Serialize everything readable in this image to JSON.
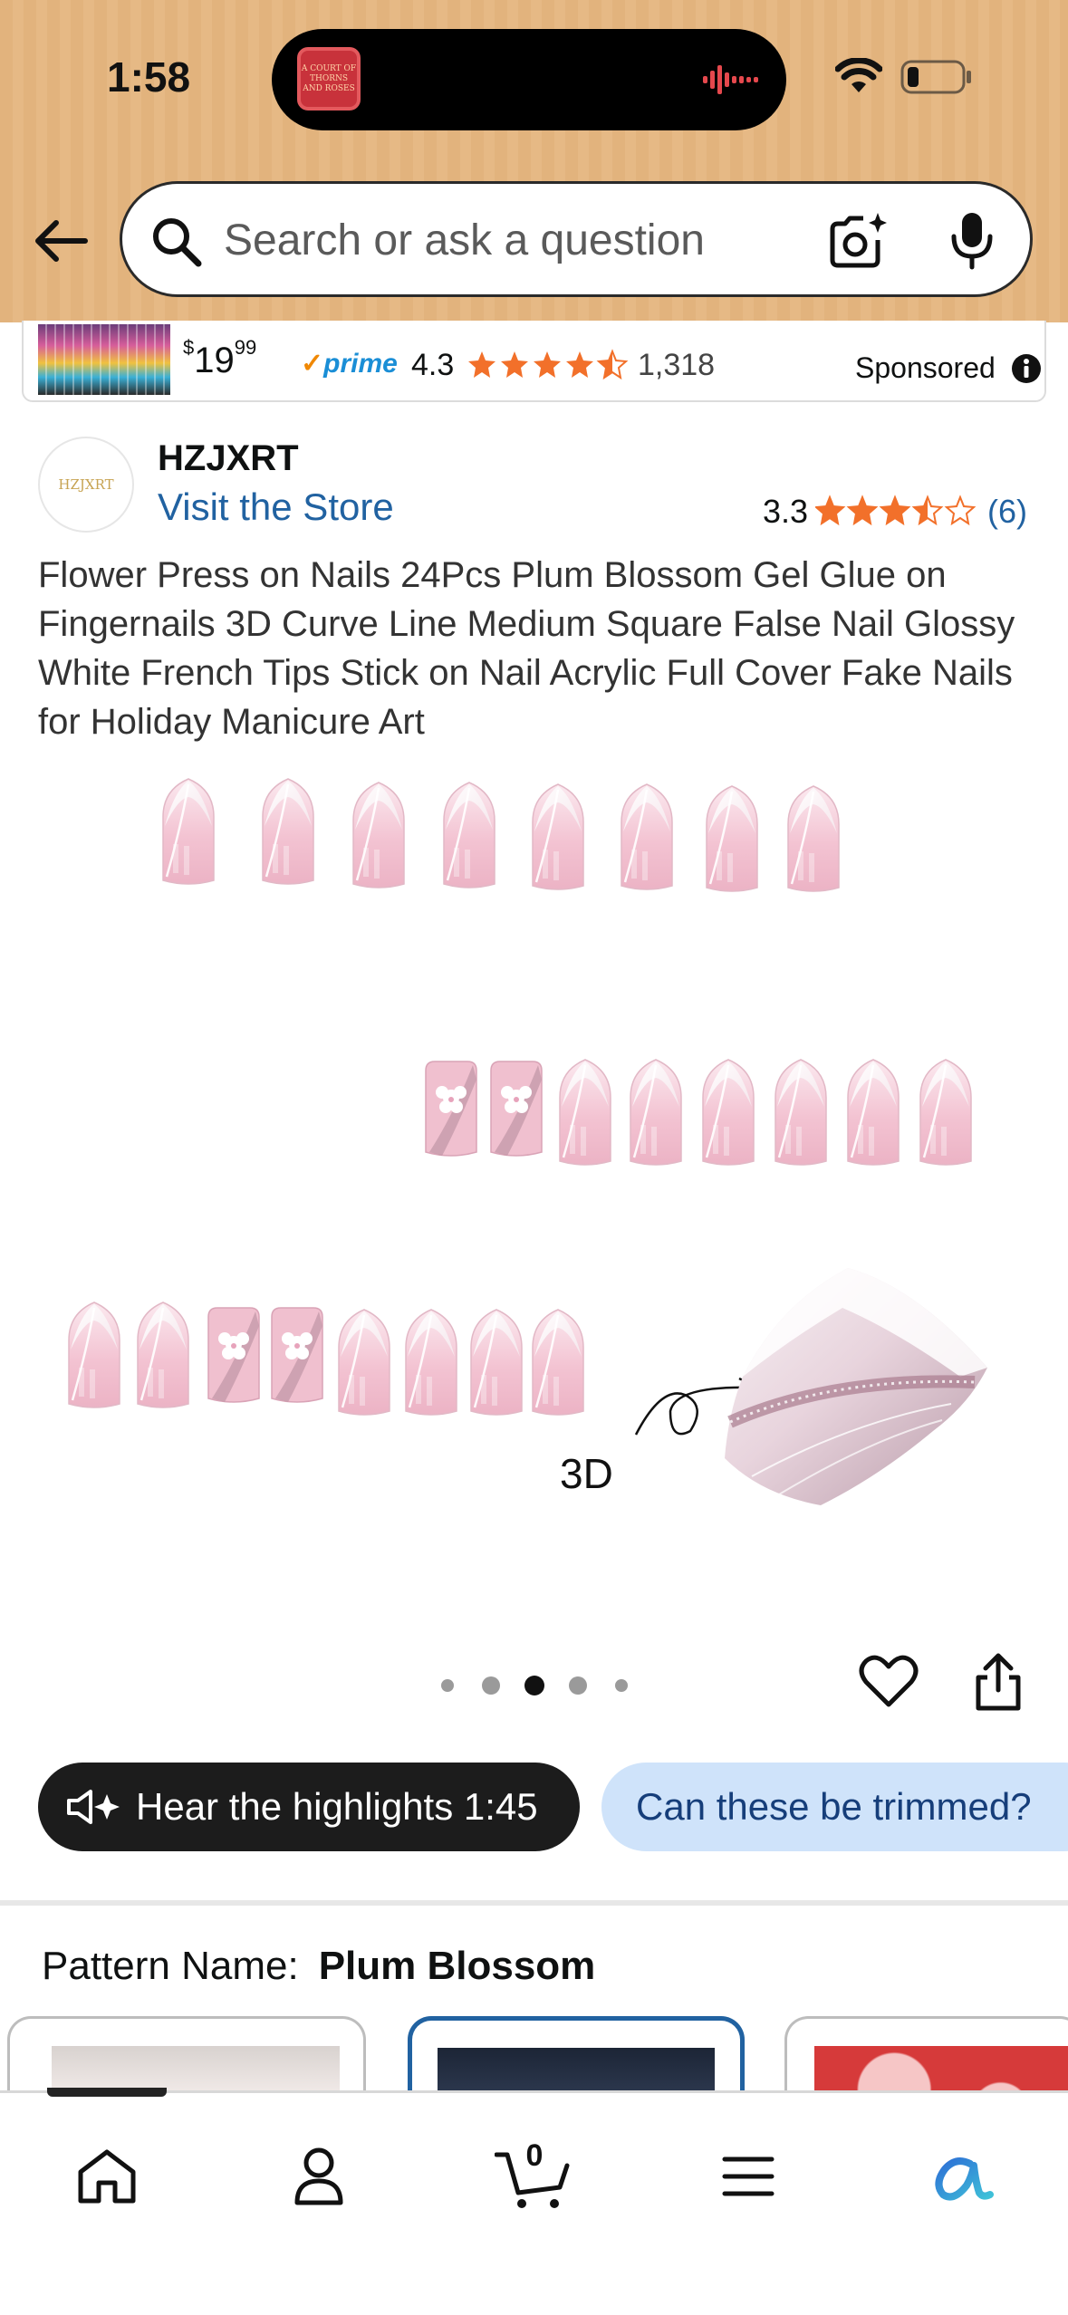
{
  "status_bar": {
    "time": "1:58",
    "now_playing_art_text": "A COURT OF THORNS AND ROSES"
  },
  "search": {
    "placeholder": "Search or ask a question"
  },
  "sponsored": {
    "price_symbol": "$",
    "price_whole": "19",
    "price_fraction": "99",
    "prime_label": "prime",
    "rating": "4.3",
    "rating_value": 4.3,
    "review_count": "1,318",
    "label": "Sponsored"
  },
  "brand": {
    "logo_text": "HZJXRT",
    "name": "HZJXRT",
    "store_link": "Visit the Store",
    "rating": "3.3",
    "rating_value": 3.3,
    "review_count": "(6)"
  },
  "product": {
    "title": "Flower Press on Nails 24Pcs Plum Blossom Gel Glue on Fingernails 3D Curve Line Medium Square False Nail Glossy White French Tips Stick on Nail Acrylic Full Cover Fake Nails for Holiday Manicure Art",
    "image_label": "3D",
    "carousel_total": 5,
    "carousel_active": 3
  },
  "actions": {
    "highlights_label": "Hear the highlights 1:45",
    "question_label": "Can these be trimmed?"
  },
  "pattern": {
    "label": "Pattern Name:",
    "value": "Plum Blossom"
  },
  "tab_bar": {
    "cart_count": "0"
  },
  "colors": {
    "header_bg": "#e2b37d",
    "link_blue": "#2162a1",
    "star_orange": "#f2702a",
    "prime_blue": "#1a8ed6",
    "nail_pink": "#f2c6d3"
  }
}
